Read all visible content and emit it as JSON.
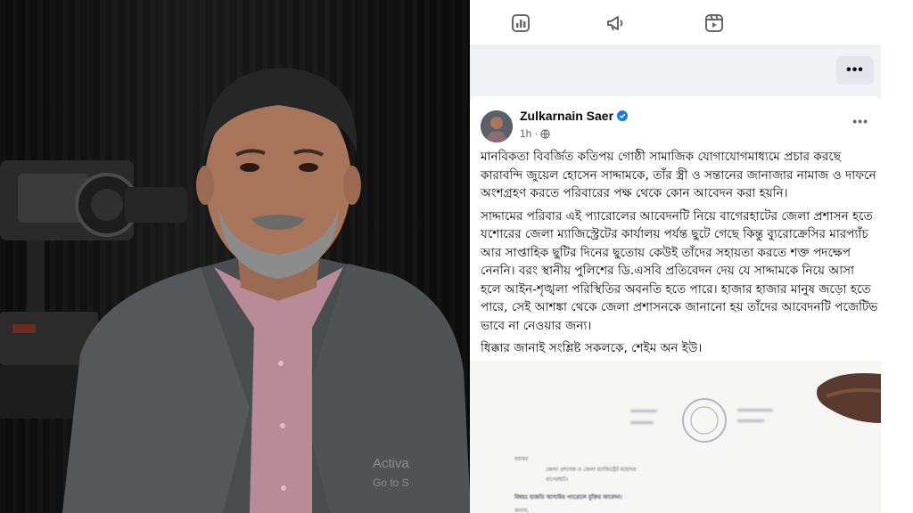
{
  "toolbar": {
    "icons": [
      "insights-icon",
      "megaphone-icon",
      "reels-icon"
    ]
  },
  "header_more": "•••",
  "post": {
    "author": "Zulkarnain Saer",
    "time": "1h",
    "more": "•••",
    "paragraphs": [
      "মানবিকতা বিবর্জিত কতিপয় গোষ্ঠী সামাজিক যোগাযোগমাধ্যমে প্রচার করছে কারাবন্দি জুয়েল হোসেন সাদ্দামকে, তাঁর স্ত্রী ও সন্তানের জানাজার নামাজ ও দাফনে অংশগ্রহণ করতে পরিবারের পক্ষ থেকে কোন আবেদন করা হয়নি।",
      "সাদ্দামের পরিবার এই প্যারোলের আবেদনটি নিয়ে বাগেরহাটের জেলা প্রশাসন হতে যশোরের জেলা ম্যাজিস্ট্রেটের কার্যালয় পর্যন্ত ছুটে গেছে কিন্তু ব্যুরোক্রেসির মারপ্যাঁচ আর সাপ্তাহিক ছুটির দিনের ছুতোয় কেউই তাঁদের সহায়তা করতে শক্ত পদক্ষেপ নেননি। বরং স্থানীয় পুলিশের ডি.এসবি প্রতিবেদন দেয় যে সাদ্দামকে নিয়ে আসা হলে আইন-শৃঙ্খলা পরিস্থিতির অবনতি হতে পারে। হাজার হাজার মানুষ জড়ো হতে পারে, সেই আশঙ্কা থেকে জেলা প্রশাসনকে জানানো হয় তাঁদের আবেদনটি পজেটিভ ভাবে না নেওয়ার জন্য।",
      "ধিক্কার জানাই সংশ্লিষ্ট সকলকে, শেইম অন ইউ।"
    ]
  },
  "document": {
    "lines": [
      "বরাবর",
      "জেলা প্রশাসক ও জেলা ম্যাজিস্ট্রেট মহোদয়",
      "বাগেরহাট।",
      "বিষয়ঃ হাজতি আসামির প্যারোলে মুক্তির আবেদন।",
      "জনাব,"
    ]
  },
  "watermark": {
    "title": "Activa",
    "subtitle": "Go to S"
  },
  "colors": {
    "facebook_blue": "#1877f2",
    "text": "#050505",
    "secondary_text": "#65676b",
    "panel_bg": "#f0f2f5"
  }
}
